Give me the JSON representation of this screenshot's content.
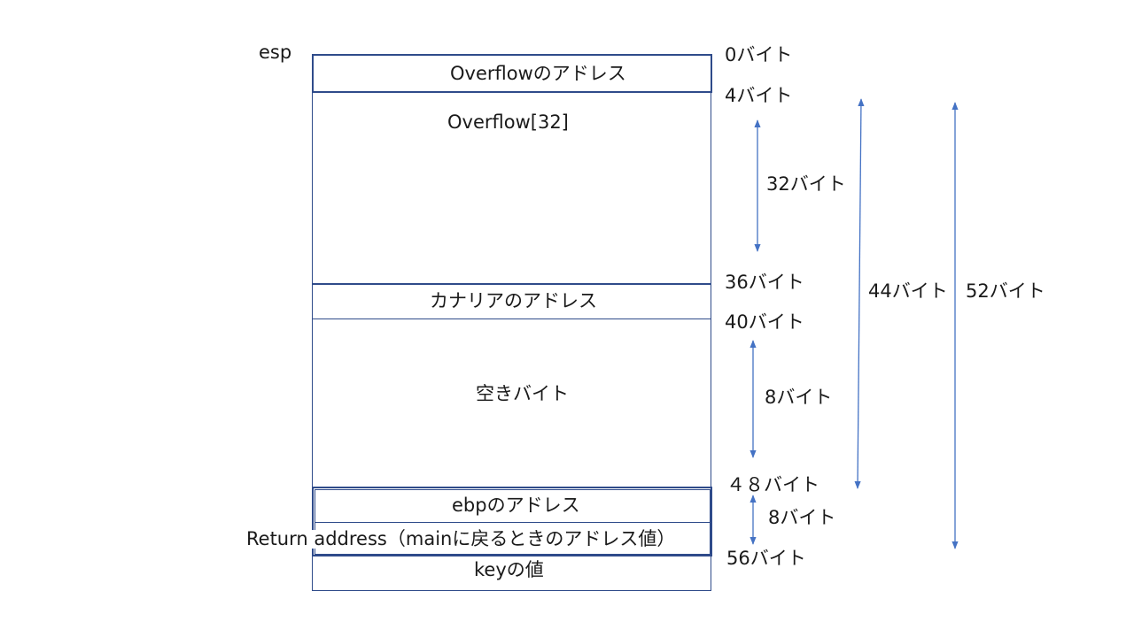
{
  "stack_pointer_label": "esp",
  "blocks": {
    "overflow_address": "Overflowのアドレス",
    "overflow_buffer": "Overflow[32]",
    "canary_address": "カナリアのアドレス",
    "empty_bytes": "空きバイト",
    "ebp_address": "ebpのアドレス",
    "return_address": "Return address（mainに戻るときのアドレス値）",
    "key_value": "keyの値"
  },
  "offsets": {
    "b0": "0バイト",
    "b4": "4バイト",
    "b36": "36バイト",
    "b40": "40バイト",
    "b48": "４８バイト",
    "b56": "56バイト"
  },
  "spans": {
    "s32": "32バイト",
    "s8a": "8バイト",
    "s8b": "8バイト",
    "s44": "44バイト",
    "s52": "52バイト"
  },
  "colors": {
    "border": "#2f4b8a",
    "arrow": "#4472c4"
  }
}
